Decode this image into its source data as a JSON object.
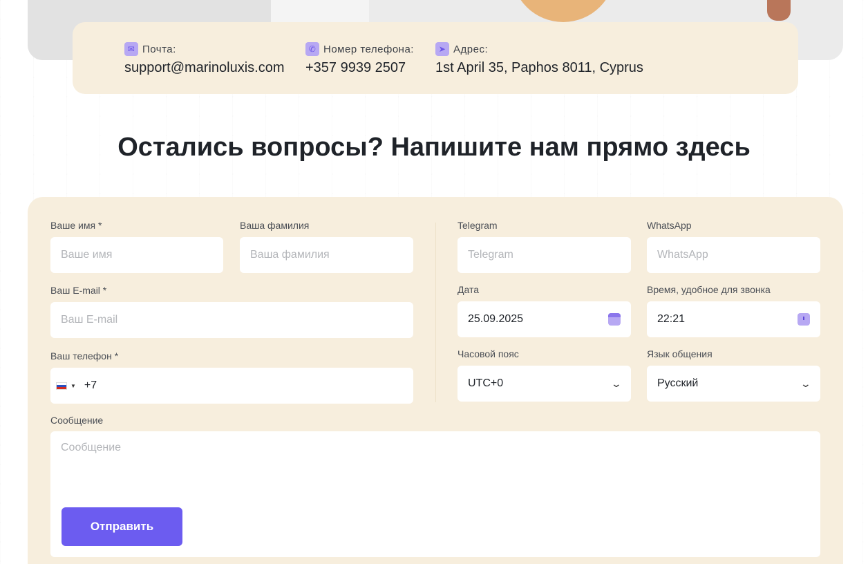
{
  "contacts": {
    "email": {
      "label": "Почта:",
      "value": "support@marinoluxis.com",
      "icon": "mail-icon"
    },
    "phone": {
      "label": "Номер телефона:",
      "value": "+357 9939 2507",
      "icon": "phone-icon"
    },
    "address": {
      "label": "Адрес:",
      "value": "1st April 35, Paphos 8011, Cyprus",
      "icon": "location-icon"
    }
  },
  "title": "Остались вопросы? Напишите нам прямо здесь",
  "form": {
    "first_name": {
      "label": "Ваше имя *",
      "placeholder": "Ваше имя"
    },
    "last_name": {
      "label": "Ваша фамилия",
      "placeholder": "Ваша фамилия"
    },
    "email": {
      "label": "Ваш E-mail *",
      "placeholder": "Ваш E-mail"
    },
    "phone": {
      "label": "Ваш телефон *",
      "value": "+7",
      "country": "RU"
    },
    "telegram": {
      "label": "Telegram",
      "placeholder": "Telegram"
    },
    "whatsapp": {
      "label": "WhatsApp",
      "placeholder": "WhatsApp"
    },
    "date": {
      "label": "Дата",
      "value": "25.09.2025"
    },
    "time": {
      "label": "Время, удобное для звонка",
      "value": "22:21"
    },
    "timezone": {
      "label": "Часовой пояс",
      "value": "UTC+0"
    },
    "language": {
      "label": "Язык общения",
      "value": "Русский"
    },
    "message": {
      "label": "Сообщение",
      "placeholder": "Сообщение"
    },
    "submit": "Отправить"
  },
  "colors": {
    "card_bg": "#f7eedd",
    "accent": "#6c5cf0",
    "icon_bg": "#b7a8f3"
  }
}
